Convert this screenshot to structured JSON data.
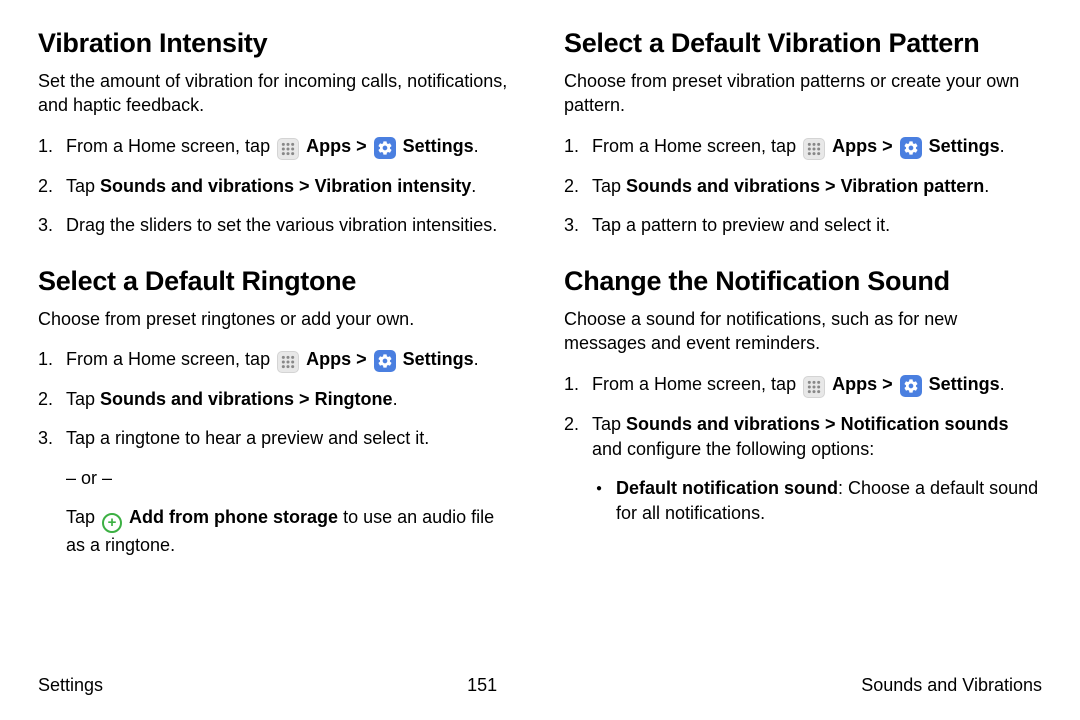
{
  "left": {
    "sect1": {
      "title": "Vibration Intensity",
      "intro": "Set the amount of vibration for incoming calls, notifications, and haptic feedback.",
      "step1_a": "From a Home screen, tap ",
      "apps": "Apps",
      "chev": " > ",
      "settings": "Settings",
      "period": ".",
      "step2_a": "Tap ",
      "step2_b": "Sounds and vibrations > Vibration intensity",
      "step3": "Drag the sliders to set the various vibration intensities."
    },
    "sect2": {
      "title": "Select a Default Ringtone",
      "intro": "Choose from preset ringtones or add your own.",
      "step1_a": "From a Home screen, tap ",
      "apps": "Apps",
      "chev": " > ",
      "settings": "Settings",
      "period": ".",
      "step2_a": "Tap ",
      "step2_b": "Sounds and vibrations > Ringtone",
      "step3": "Tap a ringtone to hear a preview and select it.",
      "or": "– or –",
      "step3b_a": "Tap ",
      "step3b_b": "Add from phone storage",
      "step3b_c": " to use an audio file as a ringtone."
    }
  },
  "right": {
    "sect1": {
      "title": "Select a Default Vibration Pattern",
      "intro": "Choose from preset vibration patterns or create your own pattern.",
      "step1_a": "From a Home screen, tap ",
      "apps": "Apps",
      "chev": " > ",
      "settings": "Settings",
      "period": ".",
      "step2_a": "Tap ",
      "step2_b": "Sounds and vibrations > Vibration pattern",
      "step3": "Tap a pattern to preview and select it."
    },
    "sect2": {
      "title": "Change the Notification Sound",
      "intro": "Choose a sound for notifications, such as for new messages and event reminders.",
      "step1_a": "From a Home screen, tap ",
      "apps": "Apps",
      "chev": " > ",
      "settings": "Settings",
      "period": ".",
      "step2_a": "Tap ",
      "step2_b": "Sounds and vibrations > Notification sounds",
      "step2_c": " and configure the following options:",
      "bullet_a": "Default notification sound",
      "bullet_b": ": Choose a default sound for all notifications."
    }
  },
  "footer": {
    "left": "Settings",
    "center": "151",
    "right": "Sounds and Vibrations"
  }
}
